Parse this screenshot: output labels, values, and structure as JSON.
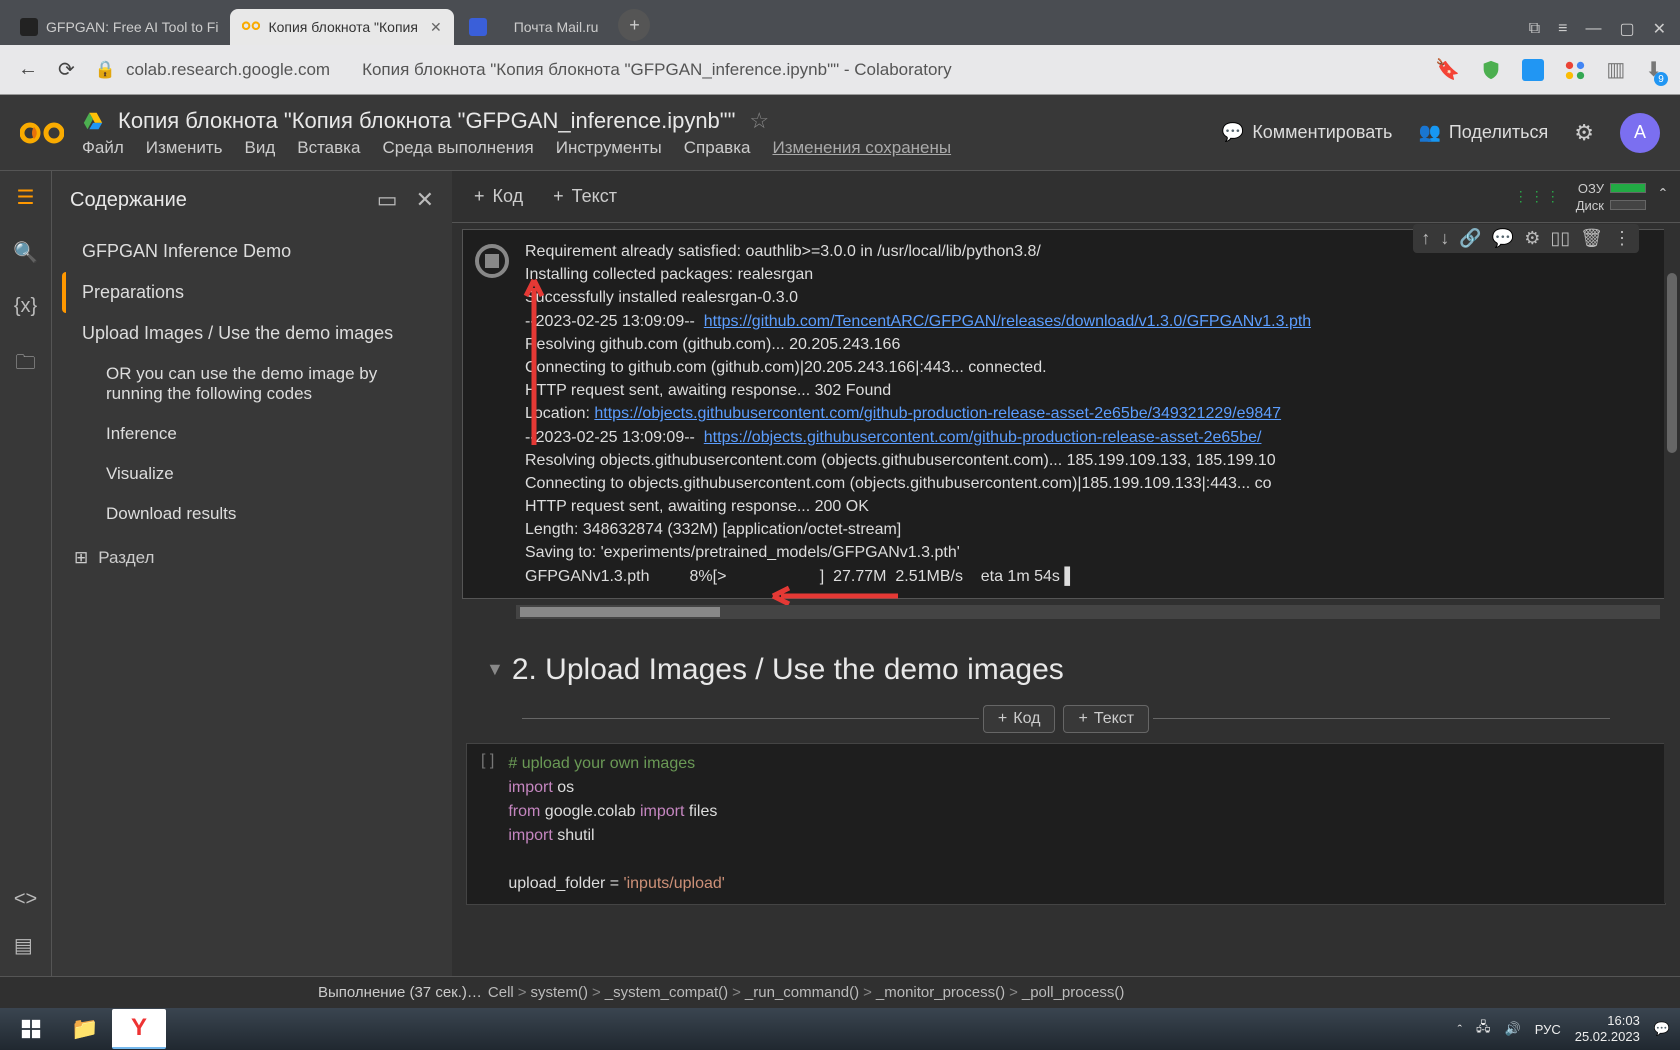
{
  "tabs": [
    {
      "title": "GFPGAN: Free AI Tool to Fi"
    },
    {
      "title": "Копия блокнота \"Копия"
    },
    {
      "title": ""
    },
    {
      "title": "Почта Mail.ru"
    }
  ],
  "url": "colab.research.google.com",
  "chrome_title": "Копия блокнота \"Копия блокнота \"GFPGAN_inference.ipynb\"\" - Colaboratory",
  "download_badge": "9",
  "doc_title": "Копия блокнота \"Копия блокнота \"GFPGAN_inference.ipynb\"\"",
  "menus": [
    "Файл",
    "Изменить",
    "Вид",
    "Вставка",
    "Среда выполнения",
    "Инструменты",
    "Справка"
  ],
  "save_status": "Изменения сохранены",
  "hdr_comment": "Комментировать",
  "hdr_share": "Поделиться",
  "avatar": "A",
  "sidebar_title": "Содержание",
  "toc": [
    {
      "t": "GFPGAN Inference Demo",
      "lvl": 1
    },
    {
      "t": "Preparations",
      "lvl": 1,
      "active": true
    },
    {
      "t": "Upload Images / Use the demo images",
      "lvl": 1
    },
    {
      "t": "OR you can use the demo image by running the following codes",
      "lvl": 2
    },
    {
      "t": "Inference",
      "lvl": 2
    },
    {
      "t": "Visualize",
      "lvl": 2
    },
    {
      "t": "Download results",
      "lvl": 2
    }
  ],
  "add_section": "Раздел",
  "toolbar": {
    "code": "Код",
    "text": "Текст",
    "ram": "ОЗУ",
    "disk": "Диск"
  },
  "output_lines": [
    {
      "pre": "Requirement already satisfied: oauthlib>=3.0.0 in /usr/local/lib/python3.8/"
    },
    {
      "pre": "Installing collected packages: realesrgan"
    },
    {
      "pre": "Successfully installed realesrgan-0.3.0"
    },
    {
      "pre": "--2023-02-25 13:09:09--  ",
      "link": "https://github.com/TencentARC/GFPGAN/releases/download/v1.3.0/GFPGANv1.3.pth"
    },
    {
      "pre": "Resolving github.com (github.com)... 20.205.243.166"
    },
    {
      "pre": "Connecting to github.com (github.com)|20.205.243.166|:443... connected."
    },
    {
      "pre": "HTTP request sent, awaiting response... 302 Found"
    },
    {
      "pre": "Location: ",
      "link": "https://objects.githubusercontent.com/github-production-release-asset-2e65be/349321229/e9847"
    },
    {
      "pre": "--2023-02-25 13:09:09--  ",
      "link": "https://objects.githubusercontent.com/github-production-release-asset-2e65be/"
    },
    {
      "pre": "Resolving objects.githubusercontent.com (objects.githubusercontent.com)... 185.199.109.133, 185.199.10"
    },
    {
      "pre": "Connecting to objects.githubusercontent.com (objects.githubusercontent.com)|185.199.109.133|:443... co"
    },
    {
      "pre": "HTTP request sent, awaiting response... 200 OK"
    },
    {
      "pre": "Length: 348632874 (332M) [application/octet-stream]"
    },
    {
      "pre": "Saving to: 'experiments/pretrained_models/GFPGANv1.3.pth'"
    },
    {
      "pre": ""
    },
    {
      "pre": "GFPGANv1.3.pth         8%[>                     ]  27.77M  2.51MB/s    eta 1m 54s ▌"
    }
  ],
  "section_heading": "2. Upload Images / Use the demo images",
  "insert": {
    "code": "Код",
    "text": "Текст"
  },
  "cell_gutter": "[ ]",
  "code_lines": [
    {
      "type": "comment",
      "t": "# upload your own images"
    },
    {
      "type": "impos",
      "kw": "import",
      "rest": " os"
    },
    {
      "type": "from",
      "kw1": "from",
      "mid": " google.colab ",
      "kw2": "import",
      "rest": " files"
    },
    {
      "type": "impos",
      "kw": "import",
      "rest": " shutil"
    },
    {
      "type": "blank"
    },
    {
      "type": "assign",
      "pre": "upload_folder = ",
      "str": "'inputs/upload'"
    }
  ],
  "status": {
    "running": "Выполнение (37 сек.)…",
    "crumbs": [
      "Cell",
      "system()",
      "_system_compat()",
      "_run_command()",
      "_monitor_process()",
      "_poll_process()"
    ]
  },
  "tray": {
    "lang": "РУС",
    "time": "16:03",
    "date": "25.02.2023"
  }
}
